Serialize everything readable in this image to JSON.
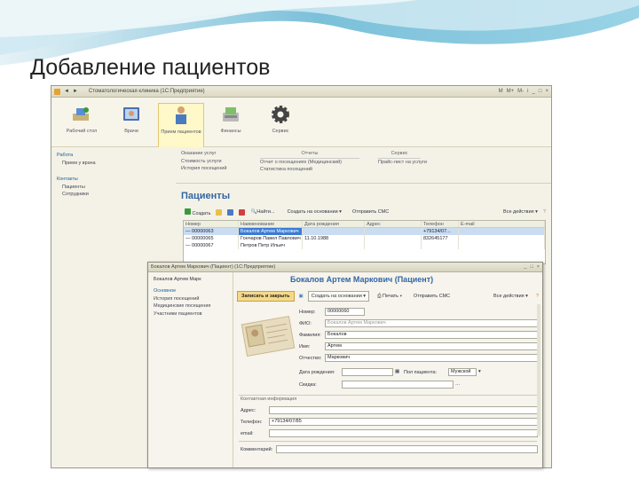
{
  "slide": {
    "title": "Добавление пациентов"
  },
  "window": {
    "title": "Стоматологическая клиника (1С:Предприятие)",
    "controls": [
      "M",
      "M+",
      "M-",
      "i",
      "_",
      "□",
      "×"
    ]
  },
  "sections": [
    {
      "label": "Рабочий стол",
      "icon": "desktop-icon"
    },
    {
      "label": "Врачи",
      "icon": "doctor-icon"
    },
    {
      "label": "Прием пациентов",
      "icon": "patient-icon"
    },
    {
      "label": "Финансы",
      "icon": "finance-icon"
    },
    {
      "label": "Сервис",
      "icon": "gear-icon"
    }
  ],
  "nav": {
    "groups": [
      {
        "title": "Работа",
        "items": [
          "Прием у врача"
        ]
      },
      {
        "title": "Контакты",
        "items": [
          "Пациенты",
          "Сотрудники"
        ]
      }
    ]
  },
  "actions": {
    "col1": [
      "Оказание услуг",
      "Стоимость услуги",
      "История посещений"
    ],
    "col2_header": "Отчеты",
    "col2": [
      "Отчет о посещениях (Медицинский)",
      "Статистика посещений"
    ],
    "col3_header": "Сервис",
    "col3": [
      "Прайс-лист на услуги"
    ]
  },
  "list": {
    "title": "Пациенты",
    "toolbar": {
      "create": "Создать",
      "find": "Найти...",
      "create_based_on": "Создать на основании",
      "send_sms": "Отправить СМС",
      "all_actions": "Все действия"
    },
    "columns": [
      "Номер",
      "Наименование",
      "Дата рождения",
      "Адрес",
      "Телефон",
      "E-mail"
    ],
    "rows": [
      {
        "code": "00000063",
        "name": "Бокалов Артем Маркович",
        "birth": "",
        "address": "",
        "phone": "+79134/07...",
        "selected": true
      },
      {
        "code": "00000065",
        "name": "Гончаров Павел Павлович",
        "birth": "11.10.1988",
        "address": "",
        "phone": "832645177",
        "selected": false
      },
      {
        "code": "00000067",
        "name": "Петров Петр Ильич",
        "birth": "",
        "address": "",
        "phone": "",
        "selected": false
      }
    ]
  },
  "form": {
    "window_title": "Бокалов Артем Маркович (Пациент) (1С:Предприятие)",
    "left": {
      "title": "Бокалов Артем Марк",
      "main": "Основное",
      "items": [
        "История посещений",
        "Медицинские посещения",
        "Участники пациентов"
      ]
    },
    "heading": "Бокалов Артем Маркович (Пациент)",
    "toolbar": {
      "save_close": "Записать и закрыть",
      "create_based": "Создать на основании",
      "print": "Печать",
      "send_sms": "Отправить СМС",
      "all_actions": "Все действия"
    },
    "fields": {
      "code_label": "Номер:",
      "code": "00000060",
      "fio_label": "ФИО:",
      "fio": "Бокалов Артем Маркович",
      "surname_label": "Фамилия:",
      "surname": "Бокалов",
      "name_label": "Имя:",
      "name": "Артем",
      "patronymic_label": "Отчество:",
      "patronymic": "Маркович",
      "birth_label": "Дата рождения:",
      "birth": "",
      "gender_label": "Пол пациента:",
      "gender": "Мужской",
      "card_label": "Скидка:",
      "card": "",
      "contacts_header": "Контактная информация",
      "address_label": "Адрес:",
      "address": "",
      "phone_label": "Телефон:",
      "phone": "+79134/07/85",
      "email_label": "email:",
      "email": "",
      "comment_label": "Комментарий:",
      "comment": ""
    }
  },
  "colors": {
    "accent": "#3366a6",
    "selected": "#3a7bd5",
    "primary_button": "#f5d98a"
  }
}
